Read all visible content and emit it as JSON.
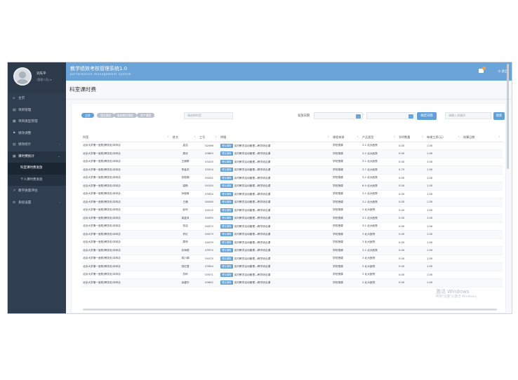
{
  "sidebar": {
    "user_name": "刘先平",
    "user_role": "(管理人员) ▾",
    "items": [
      {
        "icon": "home-icon",
        "glyph": "⌂",
        "label": "主页",
        "arrow": ""
      },
      {
        "icon": "document-icon",
        "glyph": "▤",
        "label": "项目管理",
        "arrow": ""
      },
      {
        "icon": "grid-icon",
        "glyph": "▦",
        "label": "项目类型管理",
        "arrow": ""
      },
      {
        "icon": "flag-icon",
        "glyph": "⚑",
        "label": "绩效调整",
        "arrow": ""
      },
      {
        "icon": "chart-icon",
        "glyph": "▥",
        "label": "绩效统计",
        "arrow": "›"
      },
      {
        "icon": "table-icon",
        "glyph": "▦",
        "label": "课时费统计",
        "arrow": "›"
      },
      {
        "icon": "",
        "glyph": "",
        "label": "科室课时费发放",
        "arrow": ""
      },
      {
        "icon": "",
        "glyph": "",
        "label": "个人课时费发放",
        "arrow": ""
      },
      {
        "icon": "line-chart-icon",
        "glyph": "↗",
        "label": "教学质量评估",
        "arrow": ""
      },
      {
        "icon": "settings-icon",
        "glyph": "⚙",
        "label": "系统设置",
        "arrow": "›"
      }
    ]
  },
  "header": {
    "title": "教学绩效考核管理系统1.0",
    "subtitle": "performance management system",
    "exit": "退出"
  },
  "page_title": "科室课时费",
  "filters": [
    "全部",
    "理论课程",
    "临床教学课程",
    "其产课程"
  ],
  "search_left_placeholder": "请选择科室",
  "date_label": "发放日期",
  "date_dash": "-",
  "settle_button": "确定日期",
  "search_right_placeholder": "请输入关键词",
  "search_button": "搜索",
  "table": {
    "headers": [
      "科室",
      "姓名",
      "工号",
      "明细",
      "课程来源",
      "产品类型",
      "学时数量",
      "每课工资(元)",
      "结算日期"
    ],
    "rows": [
      {
        "dept": "北京大学第一医院/教务处/本科办",
        "name": "孟洁",
        "id": "02098",
        "tag": "理论课程",
        "detail": "实时教学活动管理—教学综合课",
        "source": "学校授课",
        "type": "3.2 北大医院",
        "hours": "0.00",
        "pay": "1.00"
      },
      {
        "dept": "北京大学第一医院/教务处/本科办",
        "name": "周诗",
        "id": "03693",
        "tag": "理论课程",
        "detail": "实时教学活动管理—教学综合课",
        "source": "学校授课",
        "type": "3.2 北大医院",
        "hours": "0.00",
        "pay": "1.00"
      },
      {
        "dept": "北京大学第一医院/教务处/本科办",
        "name": "王钢群",
        "id": "03225",
        "tag": "理论课程",
        "detail": "实时教学活动管理—教学综合课",
        "source": "学校授课",
        "type": "3.2 北大医院",
        "hours": "0.00",
        "pay": "1.00"
      },
      {
        "dept": "北京大学第一医院/教务处/本科办",
        "name": "李金花",
        "id": "03514",
        "tag": "理论课程",
        "detail": "实时教学活动管理—教学综合课",
        "source": "学校授课",
        "type": "3.7 北大医院",
        "hours": "0.75",
        "pay": "1.00"
      },
      {
        "dept": "北京大学第一医院/教务处/本科办",
        "name": "张惠娟",
        "id": "04042",
        "tag": "理论课程",
        "detail": "实时教学活动管理—教学综合课",
        "source": "学校授课",
        "type": "3.2 北大医院",
        "hours": "0.00",
        "pay": "1.00"
      },
      {
        "dept": "北京大学第一医院/教务处/本科办",
        "name": "梁杨",
        "id": "04104",
        "tag": "理论课程",
        "detail": "实时教学活动管理—教学综合课",
        "source": "学校授课",
        "type": "6.9 北大医院",
        "hours": "0.00",
        "pay": "1.00"
      },
      {
        "dept": "北京大学第一医院/教务处/本科办",
        "name": "孙晓辉",
        "id": "03920",
        "tag": "理论课程",
        "detail": "实时教学活动管理—教学综合课",
        "source": "学校授课",
        "type": "3.2 北大医院",
        "hours": "0.00",
        "pay": "1.00"
      },
      {
        "dept": "北京大学第一医院/教务处/本科办",
        "name": "王通",
        "id": "04040",
        "tag": "理论课程",
        "detail": "实时教学活动管理—教学综合课",
        "source": "学校授课",
        "type": "3.2 北大医院",
        "hours": "0.00",
        "pay": "1.00"
      },
      {
        "dept": "北京大学第一医院/教务处/本科办",
        "name": "赵利",
        "id": "04015",
        "tag": "理论课程",
        "detail": "实时教学活动管理—教学综合课",
        "source": "学校授课",
        "type": "3 北大医院",
        "hours": "0.00",
        "pay": "1.00"
      },
      {
        "dept": "北京大学第一医院/教务处/本科办",
        "name": "梁金凤",
        "id": "04095",
        "tag": "理论课程",
        "detail": "实时教学活动管理—教学综合课",
        "source": "学校授课",
        "type": "3.2 北大医院",
        "hours": "0.00",
        "pay": "1.00"
      },
      {
        "dept": "北京大学第一医院/教务处/本科办",
        "name": "张洁",
        "id": "04073",
        "tag": "理论课程",
        "detail": "实时教学活动管理—教学综合课",
        "source": "学校授课",
        "type": "3.2 北大医院",
        "hours": "0.00",
        "pay": "1.00"
      },
      {
        "dept": "北京大学第一医院/教务处/本科办",
        "name": "许红",
        "id": "04073",
        "tag": "理论课程",
        "detail": "实时教学活动管理—教学综合课",
        "source": "学校授课",
        "type": "3 北大医院",
        "hours": "0.00",
        "pay": "1.00"
      },
      {
        "dept": "北京大学第一医院/教务处/本科办",
        "name": "周萍",
        "id": "04079",
        "tag": "理论课程",
        "detail": "实时教学活动管理—教学综合课",
        "source": "学校授课",
        "type": "3 北大医院",
        "hours": "0.00",
        "pay": "1.00"
      },
      {
        "dept": "北京大学第一医院/教务处/本科办",
        "name": "孙海丽",
        "id": "03974",
        "tag": "理论课程",
        "detail": "实时教学活动管理—教学综合课",
        "source": "学校授课",
        "type": "3.2 北大医院",
        "hours": "0.00",
        "pay": "1.00"
      },
      {
        "dept": "北京大学第一医院/教务处/本科办",
        "name": "成小娟",
        "id": "04075",
        "tag": "理论课程",
        "detail": "实时教学活动管理—教学综合课",
        "source": "学校授课",
        "type": "3 北大医院",
        "hours": "0.00",
        "pay": "1.00"
      },
      {
        "dept": "北京大学第一医院/教务处/本科办",
        "name": "张红霞",
        "id": "03904",
        "tag": "理论课程",
        "detail": "实时教学活动管理—教学综合课",
        "source": "学校授课",
        "type": "3 北大医院",
        "hours": "0.00",
        "pay": "1.00"
      },
      {
        "dept": "北京大学第一医院/教务处/本科办",
        "name": "苏科",
        "id": "03571",
        "tag": "理论课程",
        "detail": "实时教学活动管理—教学综合课",
        "source": "学校授课",
        "type": "3 北大医院",
        "hours": "0.00",
        "pay": "1.00"
      },
      {
        "dept": "北京大学第一医院/教务处/本科办",
        "name": "余建华",
        "id": "03692",
        "tag": "理论课程",
        "detail": "实时教学活动管理—教学综合课",
        "source": "学校授课",
        "type": "3 北大医院",
        "hours": "0.00",
        "pay": "1.00"
      }
    ]
  },
  "watermark": {
    "line1": "激活 Windows",
    "line2": "转到\"设置\"以激活 Windows。"
  },
  "colors": {
    "header": "#6aa4d9",
    "sidebar": "#2f3e50",
    "accent": "#5fa0d8"
  }
}
